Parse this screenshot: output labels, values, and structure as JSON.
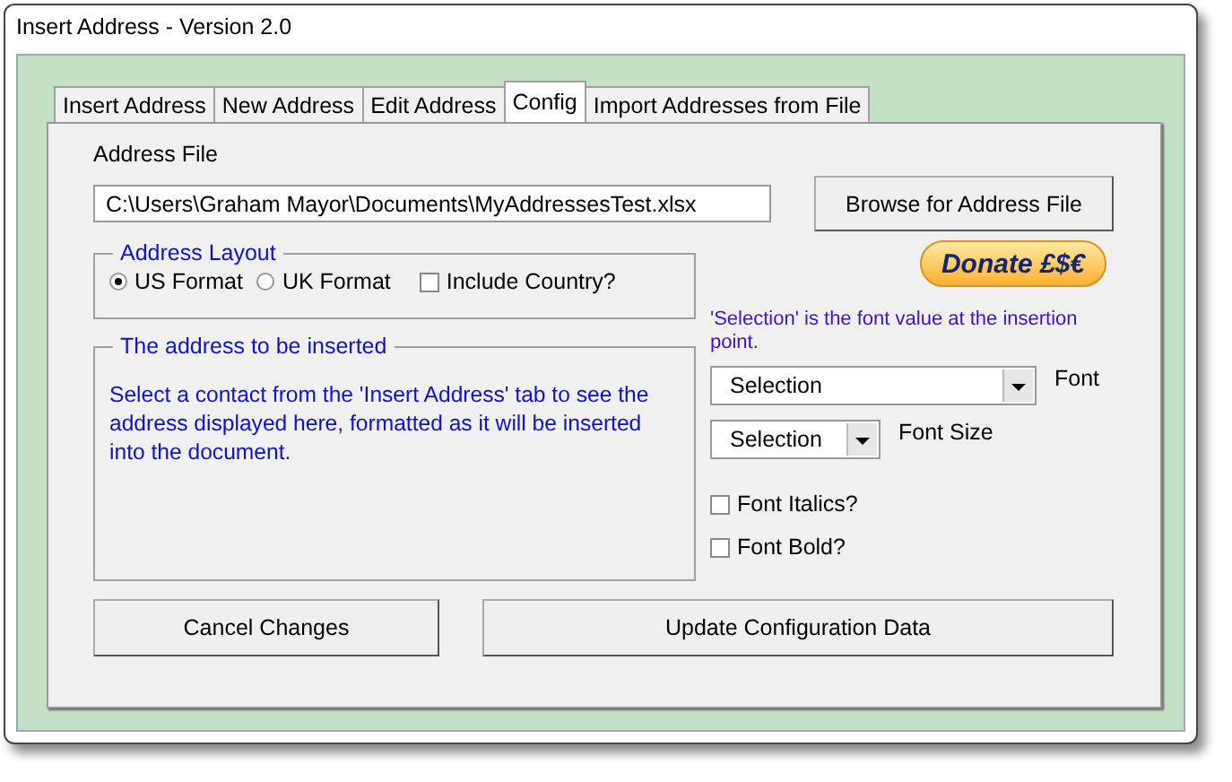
{
  "window": {
    "title": "Insert Address - Version 2.0"
  },
  "tabs": [
    {
      "label": "Insert Address",
      "selected": false
    },
    {
      "label": "New Address",
      "selected": false
    },
    {
      "label": "Edit Address",
      "selected": false
    },
    {
      "label": "Config",
      "selected": true
    },
    {
      "label": "Import Addresses from File",
      "selected": false
    }
  ],
  "address_file": {
    "label": "Address File",
    "value": "C:\\Users\\Graham Mayor\\Documents\\MyAddressesTest.xlsx",
    "browse_button": "Browse for Address File"
  },
  "address_layout": {
    "title": "Address Layout",
    "options": [
      {
        "label": "US Format",
        "selected": true
      },
      {
        "label": "UK Format",
        "selected": false
      }
    ],
    "include_country": {
      "label": "Include Country?",
      "checked": false
    }
  },
  "preview": {
    "title": "The address to be inserted",
    "text": "Select a contact from the 'Insert Address' tab to see the address displayed here, formatted as it will be inserted into the document."
  },
  "donate_button": "Donate £$€",
  "font_note": "'Selection' is the font value at the insertion point.",
  "font": {
    "value": "Selection",
    "label": "Font"
  },
  "font_size": {
    "value": "Selection",
    "label": "Font Size"
  },
  "options": [
    {
      "label": "Font Italics?",
      "checked": false
    },
    {
      "label": "Font Bold?",
      "checked": false
    }
  ],
  "buttons": [
    "Cancel Changes",
    "Update Configuration Data"
  ]
}
